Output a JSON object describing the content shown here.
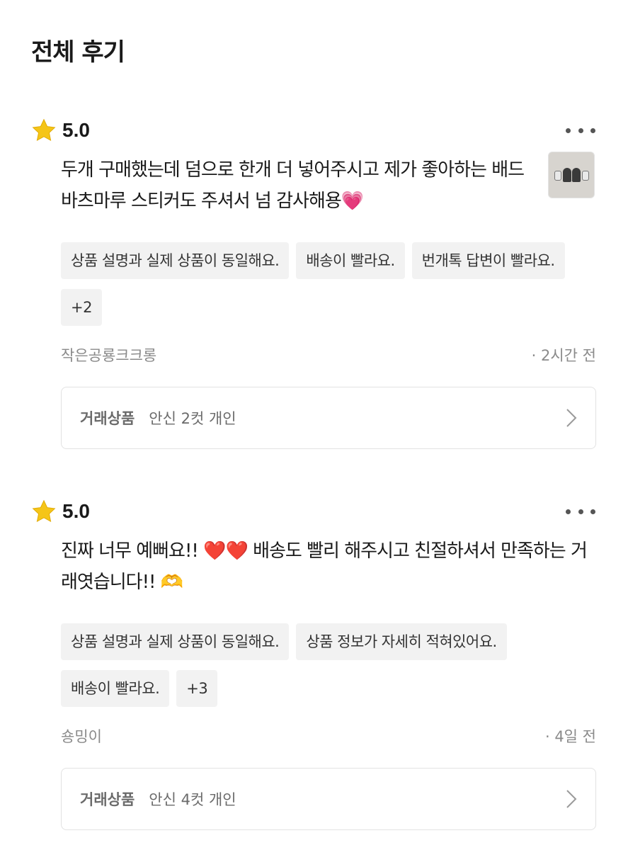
{
  "page": {
    "title": "전체 후기"
  },
  "reviews": [
    {
      "rating": "5.0",
      "text": "두개 구매했는데 덤으로 한개 더 넣어주시고 제가 좋아하는 배드바츠마루 스티커도 주셔서 넘 감사해용💗",
      "tags": [
        "상품 설명과 실제 상품이 동일해요.",
        "배송이 빨라요.",
        "번개톡 답변이 빨라요.",
        "+2"
      ],
      "author": "작은공룡크크롱",
      "time": "· 2시간 전",
      "item_label": "거래상품",
      "item_name": "안신 2컷 개인"
    },
    {
      "rating": "5.0",
      "text": "진짜 너무 예뻐요!! ❤️❤️ 배송도 빨리 해주시고 친절하셔서 만족하는 거래엿습니다!! 🫶",
      "tags": [
        "상품 설명과 실제 상품이 동일해요.",
        "상품 정보가 자세히 적혀있어요.",
        "배송이 빨라요.",
        "+3"
      ],
      "author": "숑밍이",
      "time": "· 4일 전",
      "item_label": "거래상품",
      "item_name": "안신 4컷 개인"
    }
  ],
  "colors": {
    "star": "#F5C518",
    "tag_bg": "#F2F2F2",
    "meta": "#8A8A8A"
  },
  "icons": [
    "star-icon",
    "more-icon",
    "chevron-right-icon"
  ]
}
